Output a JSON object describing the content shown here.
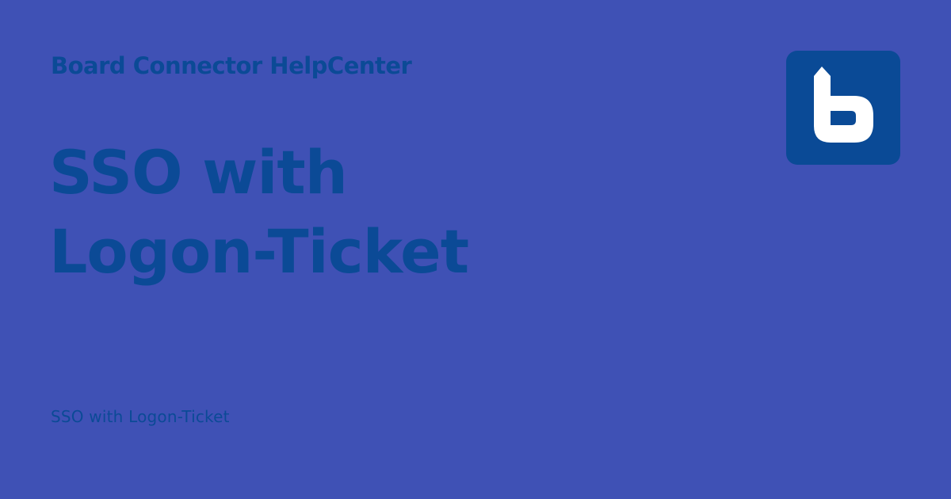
{
  "site": {
    "name": "Board Connector HelpCenter"
  },
  "headline": {
    "line1": "SSO with",
    "line2": "Logon-Ticket"
  },
  "footer": {
    "text": "SSO with Logon-Ticket"
  },
  "logo": {
    "icon": "board-b-logo-icon",
    "background_color": "#0a4a96",
    "glyph_color": "#ffffff"
  },
  "colors": {
    "background": "#3f51b5",
    "text": "#0b4a96"
  }
}
